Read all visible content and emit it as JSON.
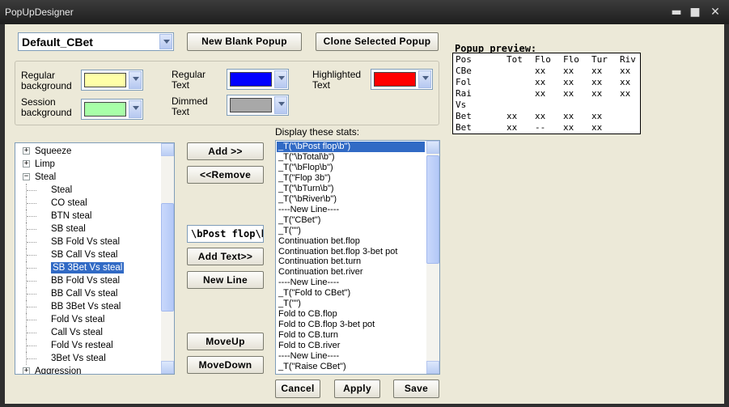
{
  "window": {
    "title": "PopUpDesigner",
    "min_glyph": "▬",
    "max_glyph": "■",
    "close_glyph": "✕"
  },
  "toolbar": {
    "popup_select_value": "Default_CBet",
    "new_blank_label": "New Blank Popup",
    "clone_label": "Clone Selected Popup"
  },
  "colors": {
    "regular_background": {
      "label": "Regular background",
      "value": "#ffffa8"
    },
    "session_background": {
      "label": "Session background",
      "value": "#a8ffa8"
    },
    "regular_text": {
      "label": "Regular Text",
      "value": "#0000ff"
    },
    "dimmed_text": {
      "label": "Dimmed Text",
      "value": "#a8a8a8"
    },
    "highlighted_text": {
      "label": "Highlighted Text",
      "value": "#ff0000"
    }
  },
  "tree": {
    "items": [
      {
        "label": "Squeeze",
        "expander": "+"
      },
      {
        "label": "Limp",
        "expander": "+"
      },
      {
        "label": "Steal",
        "expander": "−"
      },
      {
        "label": "Steal"
      },
      {
        "label": "CO steal"
      },
      {
        "label": "BTN steal"
      },
      {
        "label": "SB  steal"
      },
      {
        "label": "SB Fold Vs steal"
      },
      {
        "label": "SB Call Vs steal"
      },
      {
        "label": "SB 3Bet Vs steal",
        "selected": true
      },
      {
        "label": "BB Fold Vs steal"
      },
      {
        "label": "BB Call Vs steal"
      },
      {
        "label": "BB 3Bet Vs steal"
      },
      {
        "label": "Fold Vs steal"
      },
      {
        "label": "Call Vs steal"
      },
      {
        "label": "Fold Vs resteal"
      },
      {
        "label": "3Bet Vs steal"
      },
      {
        "label": "Aggression",
        "expander": "+"
      }
    ]
  },
  "middle": {
    "add_label": "Add >>",
    "remove_label": "<<Remove",
    "text_value": "\\bPost flop\\b",
    "add_text_label": "Add Text>>",
    "new_line_label": "New Line",
    "move_up_label": "MoveUp",
    "move_down_label": "MoveDown"
  },
  "stats": {
    "header": "Display these stats:",
    "items": [
      "_T(\"\\bPost flop\\b\")",
      "_T(\"\\bTotal\\b\")",
      "_T(\"\\bFlop\\b\")",
      "_T(\"Flop 3b\")",
      "_T(\"\\bTurn\\b\")",
      "_T(\"\\bRiver\\b\")",
      "----New Line----",
      "_T(\"CBet\")",
      "_T(\"\")",
      "Continuation bet.flop",
      "Continuation bet.flop 3-bet pot",
      "Continuation bet.turn",
      "Continuation bet.river",
      "----New Line----",
      "_T(\"Fold to CBet\")",
      "_T(\"\")",
      "Fold to CB.flop",
      "Fold to CB.flop 3-bet pot",
      "Fold to CB.turn",
      "Fold to CB.river",
      "----New Line----",
      "_T(\"Raise CBet\")"
    ]
  },
  "bottom": {
    "cancel_label": "Cancel",
    "apply_label": "Apply",
    "save_label": "Save"
  },
  "preview": {
    "title": "Popup preview:",
    "rows": [
      [
        "Pos",
        "Tot",
        "Flo",
        "Flo",
        "Tur",
        "Riv"
      ],
      [
        "CBe",
        "",
        "xx",
        "xx",
        "xx",
        "xx"
      ],
      [
        "Fol",
        "",
        "xx",
        "xx",
        "xx",
        "xx"
      ],
      [
        "Rai",
        "",
        "xx",
        "xx",
        "xx",
        "xx"
      ],
      [
        "Vs",
        "",
        "",
        "",
        "",
        ""
      ],
      [
        "Bet",
        "xx",
        "xx",
        "xx",
        "xx",
        ""
      ],
      [
        "Bet",
        "xx",
        "--",
        "xx",
        "xx",
        ""
      ]
    ]
  }
}
